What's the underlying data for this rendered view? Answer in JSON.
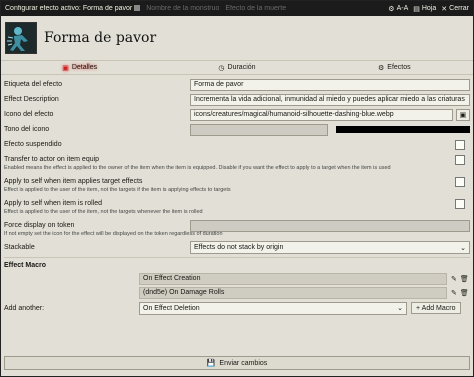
{
  "window": {
    "title": "Configurar efecto activo: Forma de pavor",
    "ghost_tabs": [
      "Nombre de la monstruo",
      "Efecto de la muerte"
    ],
    "font_control": "A-A",
    "sheet_label": "Hoja",
    "close_label": "Cerrar"
  },
  "header": {
    "name": "Forma de pavor",
    "avatar_icon": "humanoid-silhouette-icon"
  },
  "tabs": [
    {
      "label": "Detalles",
      "icon": "details-icon"
    },
    {
      "label": "Duración",
      "icon": "clock-icon"
    },
    {
      "label": "Efectos",
      "icon": "cogs-icon"
    }
  ],
  "fields": {
    "etiqueta": {
      "label": "Etiqueta del efecto",
      "value": "Forma de pavor"
    },
    "description": {
      "label": "Effect Description",
      "value": "Incrementa la vida adicional, inmunidad al miedo y puedes aplicar miedo a las criaturas"
    },
    "icono": {
      "label": "Icono del efecto",
      "value": "icons/creatures/magical/humanoid-silhouette-dashing-blue.webp"
    },
    "tono": {
      "label": "Tono del icono",
      "value": "",
      "color": "#000000"
    },
    "suspendido": {
      "label": "Efecto suspendido"
    },
    "transfer": {
      "label": "Transfer to actor on item equip",
      "hint": "Enabled means the effect is applied to the owner of the item when the item is equipped. Disable if you want the effect to apply to a target when the item is used"
    },
    "apply_target": {
      "label": "Apply to self when item applies target effects",
      "hint": "Effect is applied to the user of the item, not the targets if the item is applying effects to targets"
    },
    "apply_rolled": {
      "label": "Apply to self when item is rolled",
      "hint": "Effect is applied to the user of the item, not the targets whenever the item is rolled"
    },
    "force_display": {
      "label": "Force display on token",
      "hint": "If not empty set the icon for the effect will be displayed on the token regardless of duration"
    },
    "stackable": {
      "label": "Stackable",
      "value": "Effects do not stack by origin"
    }
  },
  "macro": {
    "title": "Effect Macro",
    "items": [
      "On Effect Creation",
      "(dnd5e) On Damage Rolls"
    ],
    "add_label": "Add another:",
    "add_select": "On Effect Deletion",
    "add_button": "+ Add Macro"
  },
  "submit": {
    "label": "Enviar cambios"
  }
}
